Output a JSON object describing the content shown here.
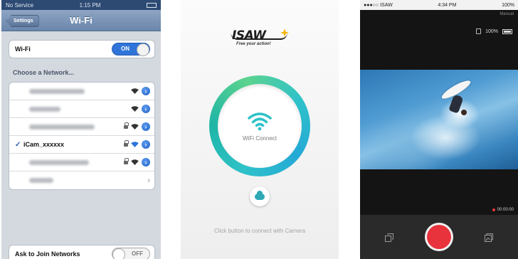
{
  "phone1": {
    "status": {
      "carrier": "No Service",
      "time": "1:15 PM"
    },
    "nav": {
      "back_label": "Settings",
      "title": "Wi-Fi"
    },
    "wifi": {
      "label": "Wi-Fi",
      "toggle": "ON"
    },
    "section_title": "Choose a Network...",
    "networks": [
      {
        "name": "",
        "blurred": true,
        "locked": false,
        "selected": false,
        "has_info": true
      },
      {
        "name": "",
        "blurred": true,
        "locked": false,
        "selected": false,
        "has_info": true
      },
      {
        "name": "",
        "blurred": true,
        "locked": true,
        "selected": false,
        "has_info": true
      },
      {
        "name": "iCam_xxxxxx",
        "blurred": false,
        "locked": true,
        "selected": true,
        "has_info": true
      },
      {
        "name": "",
        "blurred": true,
        "locked": true,
        "selected": false,
        "has_info": true
      },
      {
        "name": "",
        "blurred": true,
        "locked": false,
        "selected": false,
        "has_info": false
      }
    ],
    "check_mark": "✓",
    "ask": {
      "label": "Ask to Join Networks",
      "toggle": "OFF"
    }
  },
  "phone2": {
    "logo": {
      "main": "ISAW",
      "tagline": "Free your action!"
    },
    "connect_label": "WiFi Connect",
    "hint": "Click button to connect with Camera",
    "accent": "#2fc2c9"
  },
  "phone3": {
    "status": {
      "carrier": "●●●○○ ISAW",
      "time": "4:34 PM",
      "battery": "100%"
    },
    "manual_label": "Manual",
    "sd_capacity": "100%",
    "rec_time": "00:00:00",
    "shutter_color": "#e8323c"
  }
}
